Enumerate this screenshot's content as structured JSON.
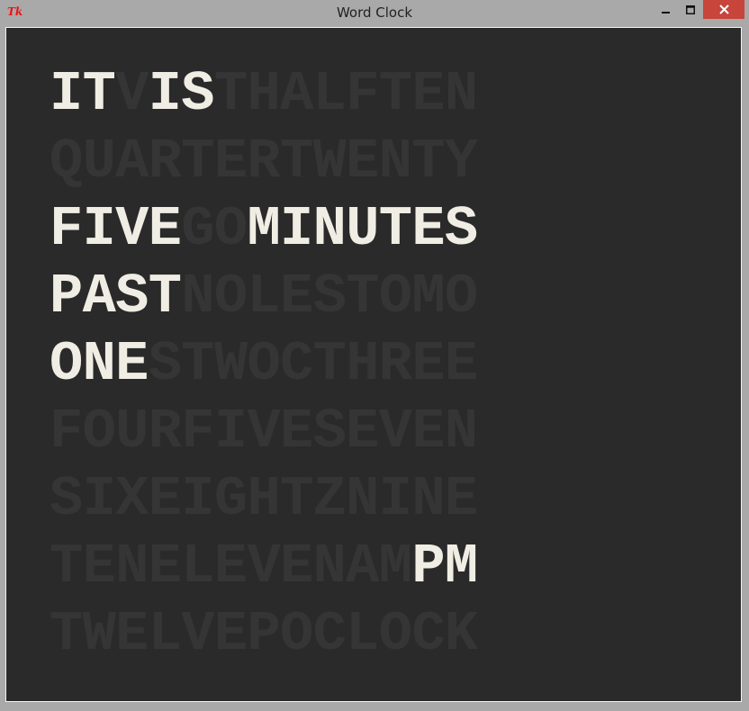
{
  "window": {
    "title": "Word Clock",
    "icon": "tk-feather-icon",
    "controls": {
      "minimize": "minimize-icon",
      "maximize": "maximize-icon",
      "close": "close-icon"
    }
  },
  "colors": {
    "background": "#2a2a2a",
    "lit": "#f0ede4",
    "dim": "#353535",
    "close_button": "#c7453b"
  },
  "clock": {
    "rows": [
      [
        {
          "t": "IT",
          "on": true
        },
        {
          "t": "V",
          "on": false
        },
        {
          "t": "IS",
          "on": true
        },
        {
          "t": "THALFTEN",
          "on": false
        }
      ],
      [
        {
          "t": "QUARTERTWENTY",
          "on": false
        }
      ],
      [
        {
          "t": "FIVE",
          "on": true
        },
        {
          "t": "GO",
          "on": false
        },
        {
          "t": "MINUTES",
          "on": true
        }
      ],
      [
        {
          "t": "PAST",
          "on": true
        },
        {
          "t": "NOLESTOMO",
          "on": false
        }
      ],
      [
        {
          "t": "ONE",
          "on": true
        },
        {
          "t": "STWOCTHREE",
          "on": false
        }
      ],
      [
        {
          "t": "FOURFIVESEVEN",
          "on": false
        }
      ],
      [
        {
          "t": "SIXEIGHTZNINE",
          "on": false
        }
      ],
      [
        {
          "t": "TENELEVENAM",
          "on": false
        },
        {
          "t": "PM",
          "on": true
        }
      ],
      [
        {
          "t": "TWELVEPOCLOCK",
          "on": false
        }
      ]
    ]
  }
}
